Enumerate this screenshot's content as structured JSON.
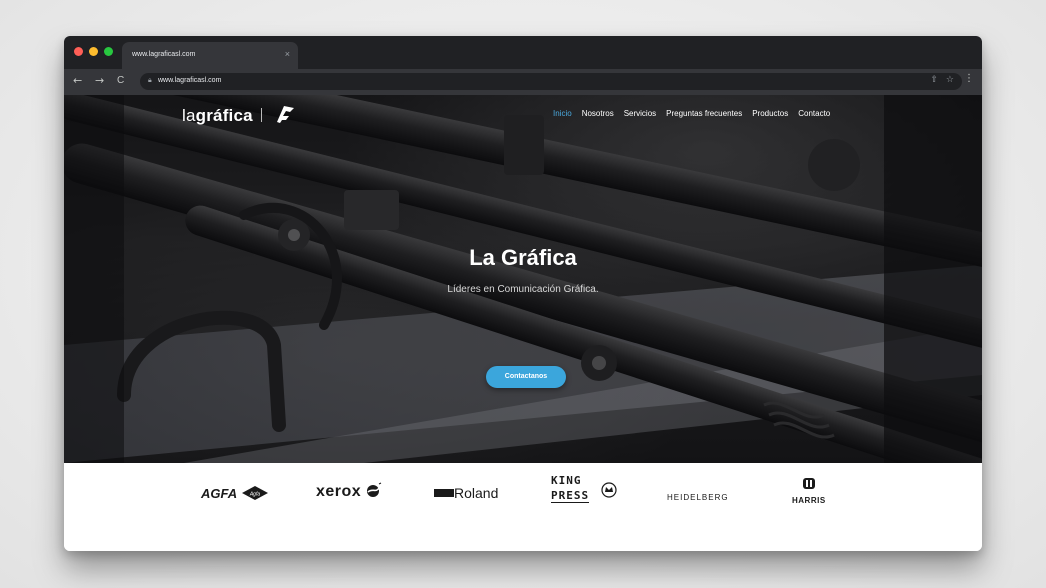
{
  "browser": {
    "tab_title": "www.lagraficasl.com",
    "tab_close": "×",
    "url": "www.lagraficasl.com",
    "nav": {
      "back": "←",
      "forward": "→",
      "reload": "C"
    },
    "icons": {
      "lock": "lock-icon",
      "share": "share-icon",
      "bookmark": "star-icon",
      "menu": "menu-dots-icon"
    }
  },
  "site": {
    "logo_light": "la",
    "logo_bold": "gráfica",
    "nav": [
      "Inicio",
      "Nosotros",
      "Servicios",
      "Preguntas frecuentes",
      "Productos",
      "Contacto"
    ],
    "active_nav": "Inicio",
    "hero_title": "La Gráfica",
    "hero_subtitle": "Líderes en Comunicación Gráfica.",
    "cta_label": "Contactanos"
  },
  "brands": {
    "agfa": "AGFA",
    "agfa_badge": "Agfa",
    "xerox": "xerox",
    "roland": "Roland",
    "kingpress_line1": "KING",
    "kingpress_line2": "PRESS",
    "heidelberg": "HEIDELBERG",
    "harris": "HARRIS"
  },
  "colors": {
    "accent": "#3ba6dc",
    "active_link": "#4aa8dd",
    "browser_dark": "#202124",
    "browser_tab": "#35363a"
  }
}
